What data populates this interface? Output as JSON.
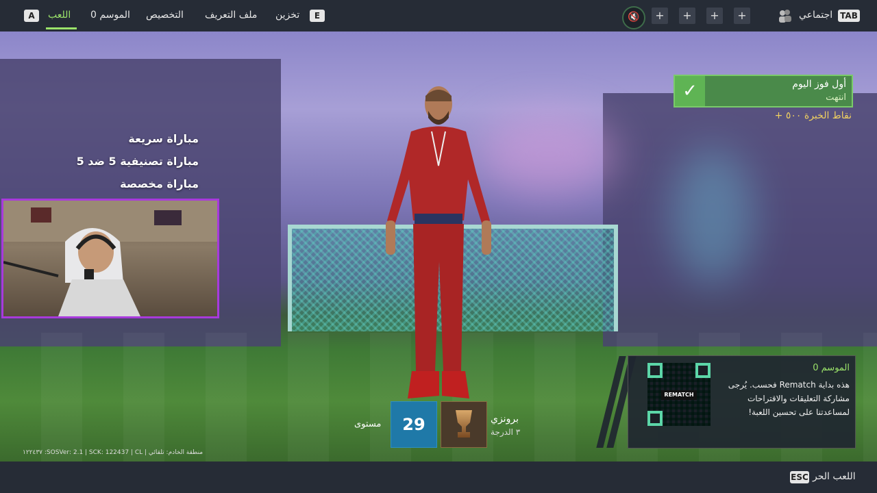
{
  "topbar": {
    "key_a": "A",
    "key_e": "E",
    "key_tab": "TAB",
    "nav": [
      {
        "label": "اللعب",
        "active": true
      },
      {
        "label": "الموسم 0"
      },
      {
        "label": "التخصيص"
      },
      {
        "label": "ملف التعريف"
      },
      {
        "label": "تخزين"
      }
    ],
    "social_label": "اجتماعي",
    "plus": [
      "+",
      "+",
      "+",
      "+"
    ],
    "mute_icon": "speaker-muted-icon"
  },
  "menu": {
    "items": [
      "مباراة سريعة",
      "مباراة تصنيفية 5 ضد 5",
      "مباراة مخصصة"
    ]
  },
  "daily": {
    "title": "أول فوز اليوم",
    "status": "انتهت",
    "xp": "نقاط الخبرة ٥٠٠ +",
    "check_icon": "✓"
  },
  "season": {
    "title": "الموسم 0",
    "body": "هذه بداية Rematch فحسب. يُرجى مشاركة التعليقات والاقتراحات لمساعدتنا على تحسين اللعبة!",
    "qr_logo": "REMATCH"
  },
  "profile": {
    "level_label": "مستوى",
    "level_value": "29",
    "rank_name": "برونزي",
    "rank_tier": "٣ الدرجة"
  },
  "footer": {
    "server_info": "منطقة الخادم: تلقائي | SOSVer: 2.1 | SCK: 122437 | CL: ١٢٢٤٣٧",
    "esc_key": "ESC",
    "free_play": "اللعب الحر"
  },
  "colors": {
    "accent": "#9be36a",
    "webcam_border": "#a83adc",
    "level": "#1f79a8"
  }
}
